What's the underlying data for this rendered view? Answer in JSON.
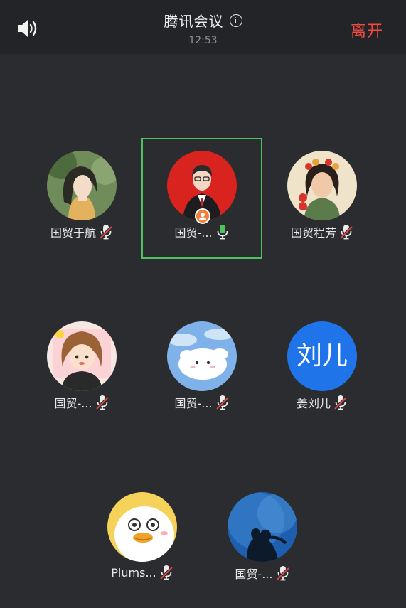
{
  "header": {
    "title": "腾讯会议",
    "clock": "12:53",
    "leave_label": "离开"
  },
  "icons": {
    "speaker": "speaker-icon",
    "info": "info-icon",
    "mic_muted": "mic-muted-icon",
    "mic_active": "mic-active-icon",
    "host_badge": "host-badge-icon"
  },
  "colors": {
    "leave": "#f04a41",
    "active_border": "#4fc25e",
    "active_mic": "#4fc25e",
    "muted_mic_slash": "#f04a41"
  },
  "participants": [
    {
      "name": "国贸于航",
      "mic": "muted"
    },
    {
      "name": "国贸-...",
      "mic": "active",
      "speaking": true,
      "host": true
    },
    {
      "name": "国贸程芳",
      "mic": "muted"
    },
    {
      "name": "国贸-...",
      "mic": "muted"
    },
    {
      "name": "国贸-...",
      "mic": "muted"
    },
    {
      "name": "姜刘儿",
      "mic": "muted",
      "avatar_text": "刘儿"
    },
    {
      "name": "Plums...",
      "mic": "muted"
    },
    {
      "name": "国贸-...",
      "mic": "muted"
    }
  ]
}
